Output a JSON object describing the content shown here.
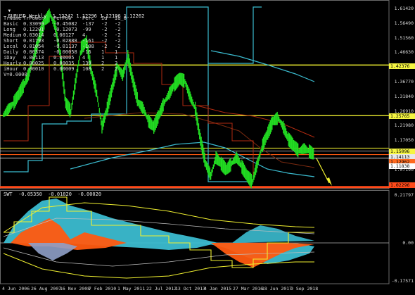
{
  "header": {
    "symbol_line": "EURUSD,Weekly  1.12242 1.12296 1.12196 1.12262",
    "arrow_glyph": "▼"
  },
  "table": {
    "headers": [
      "TrName",
      "TrPower",
      "PerPow",
      "Perc",
      "Id",
      "Id_0"
    ],
    "rows": [
      [
        "Basic",
        "0.33099",
        "-0.45082",
        "-137",
        "-2",
        "-2"
      ],
      [
        "Long",
        "0.12201",
        "-0.12073",
        "-99",
        "-2",
        "-2"
      ],
      [
        "Medium",
        "0.03014",
        "0.00127",
        "4",
        "-2",
        "-2"
      ],
      [
        "Short",
        "0.01793",
        "-0.02888",
        "-161",
        "-2",
        "-2"
      ],
      [
        "Local",
        "0.01054",
        "-0.01137",
        "-108",
        "-2",
        "-2"
      ],
      [
        "Daily",
        "0.00374",
        "-0.00058",
        "-16",
        "1",
        "1"
      ],
      [
        "iDay",
        "0.00113",
        "0.00005",
        "4",
        "1",
        "1"
      ],
      [
        "Hourly",
        "0.00025",
        "0.00035",
        "139",
        "2",
        "2"
      ],
      [
        "iHour",
        "0.00010",
        "0.00009",
        "108",
        "2",
        "2"
      ]
    ],
    "footer": "V=0.0000"
  },
  "price_axis": {
    "labels": [
      "1.61420",
      "1.56490",
      "1.51560",
      "1.46630",
      "1.41730",
      "1.36770",
      "1.31840",
      "1.26910",
      "1.21980",
      "1.17050",
      "1.12120",
      "1.07190",
      "1.02460"
    ],
    "tags": [
      {
        "text": "1.42376",
        "color": "#f5f542"
      },
      {
        "text": "1.25765",
        "color": "#f5f542"
      },
      {
        "text": "1.15096",
        "color": "#f5f542"
      },
      {
        "text": "1.14113",
        "color": "#e8e8e8"
      },
      {
        "text": "1.12962",
        "color": "#ff6a1f"
      },
      {
        "text": "1.11838",
        "color": "#ffffff"
      },
      {
        "text": "1.02296",
        "color": "#ff4a1a"
      }
    ]
  },
  "indicator": {
    "header": "SWT  -0.05350  -0.01820  -0.00020",
    "axis_labels": [
      "0.21797",
      "0.00",
      "-0.17571"
    ]
  },
  "date_axis": [
    "4 Jun 2006",
    "26 Aug 2007",
    "16 Nov 2008",
    "7 Feb 2010",
    "1 May 2011",
    "22 Jul 2012",
    "13 Oct 2013",
    "4 Jan 2015",
    "27 Mar 2016",
    "18 Jun 2017",
    "9 Sep 2018"
  ],
  "colors": {
    "price": "#22dd22",
    "cyan": "#3bbcd0",
    "orange": "#ff5a10",
    "yellow": "#f0f030",
    "red_line": "#b02a10",
    "grid": "#3a3a3a"
  }
}
